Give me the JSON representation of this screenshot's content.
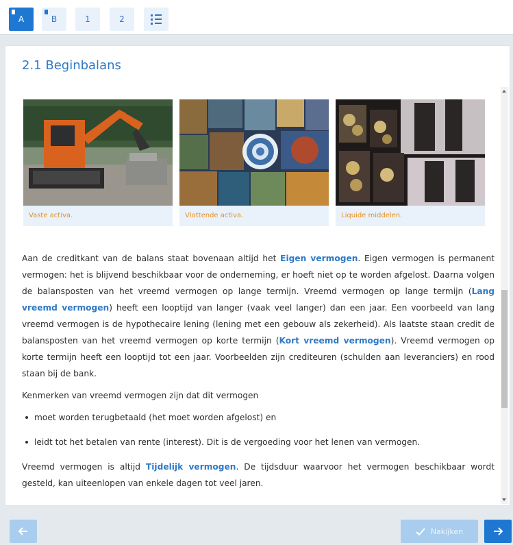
{
  "tabs": [
    {
      "label": "A",
      "active": true
    },
    {
      "label": "B",
      "active": false
    },
    {
      "label": "1",
      "active": false
    },
    {
      "label": "2",
      "active": false
    }
  ],
  "section": {
    "title": "2.1 Beginbalans"
  },
  "figures": [
    {
      "caption": "Vaste activa."
    },
    {
      "caption": "Vlottende activa."
    },
    {
      "caption": "Liquide middelen."
    }
  ],
  "body": {
    "p1_a": "Aan de creditkant van de balans staat bovenaan altijd het ",
    "p1_kw1": "Eigen vermogen",
    "p1_b": ". Eigen vermogen is permanent vermogen: het is blijvend beschikbaar voor de onderneming, er hoeft niet op te worden afgelost. Daarna volgen de balansposten van het vreemd vermogen op lange termijn. Vreemd vermogen op lange termijn (",
    "p1_kw2": "Lang vreemd vermogen",
    "p1_c": ") heeft een looptijd van langer (vaak veel langer) dan een jaar. Een voorbeeld van lang vreemd vermogen is de hypothecaire lening (lening met een gebouw als zekerheid). Als laatste staan credit de balansposten van het vreemd vermogen op korte termijn (",
    "p1_kw3": "Kort vreemd vermogen",
    "p1_d": "). Vreemd vermogen op korte termijn heeft een looptijd tot een jaar. Voorbeelden zijn crediteuren (schulden aan leveranciers) en rood staan bij de bank.",
    "p2": "Kenmerken van vreemd vermogen zijn dat dit vermogen",
    "bullets": [
      "moet worden terugbetaald (het moet worden afgelost) en",
      "leidt tot het betalen van rente (interest). Dit is de vergoeding voor het lenen van vermogen."
    ],
    "p3_a": "Vreemd vermogen is altijd ",
    "p3_kw": "Tijdelijk vermogen",
    "p3_b": ". De tijdsduur waarvoor het vermogen beschikbaar wordt gesteld, kan uiteenlopen van enkele dagen tot veel jaren."
  },
  "footer": {
    "prev_icon": "arrow-left-icon",
    "check_label": "Nakijken",
    "check_icon": "checkmark-icon",
    "next_icon": "arrow-right-icon"
  },
  "colors": {
    "accent": "#1e78d2",
    "keyword": "#2f79c6",
    "caption": "#e0902a"
  }
}
